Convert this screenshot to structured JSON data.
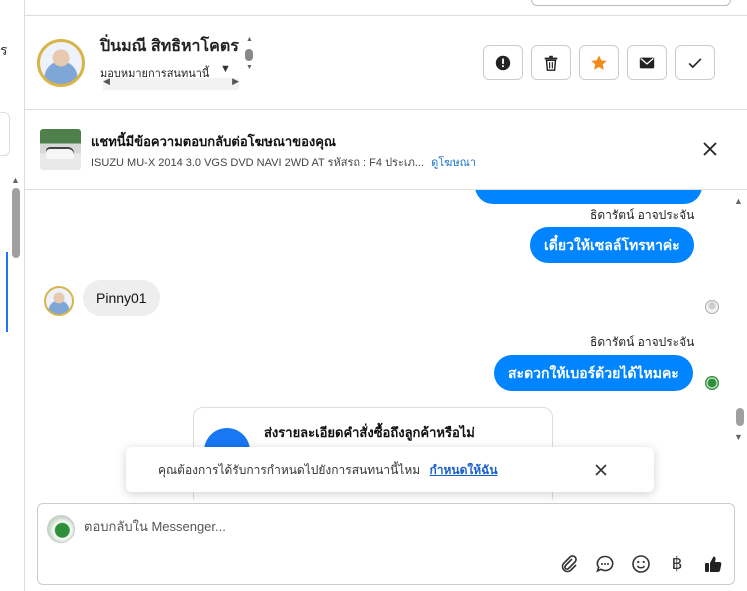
{
  "sidebar": {
    "glyph": "ร"
  },
  "header": {
    "contact_name": "ปิ่นมณี สิทธิหาโคตร",
    "assign_label": "มอบหมายการสนทนานี้",
    "actions": [
      {
        "name": "alert-icon"
      },
      {
        "name": "trash-icon"
      },
      {
        "name": "star-icon",
        "color": "#f48a1b"
      },
      {
        "name": "mail-icon"
      },
      {
        "name": "check-icon"
      }
    ]
  },
  "ad": {
    "title": "แชทนี้มีข้อความตอบกลับต่อโฆษณาของคุณ",
    "subtitle": "ISUZU MU-X 2014 3.0 VGS DVD NAVI 2WD AT รหัสรถ : F4 ประเภ...",
    "link": "ดูโฆษณา"
  },
  "messages": {
    "sender1": "ธิดารัตน์ อาจประจัน",
    "msg1": "เดี๋ยวให้เซลล์โทรหาค่ะ",
    "incoming": "Pinny01",
    "sender2": "ธิดารัตน์ อาจประจัน",
    "msg2": "สะดวกให้เบอร์ด้วยได้ไหมคะ",
    "card_title": "ส่งรายละเอียดคำสั่งซื้อถึงลูกค้าหรือไม่"
  },
  "toast": {
    "text": "คุณต้องการได้รับการกำหนดไปยังการสนทนานี้ไหม",
    "link": "กำหนดให้ฉัน"
  },
  "composer": {
    "placeholder": "ตอบกลับใน Messenger...",
    "currency_symbol": "฿"
  },
  "colors": {
    "accent": "#0084ff",
    "star": "#f48a1b"
  }
}
